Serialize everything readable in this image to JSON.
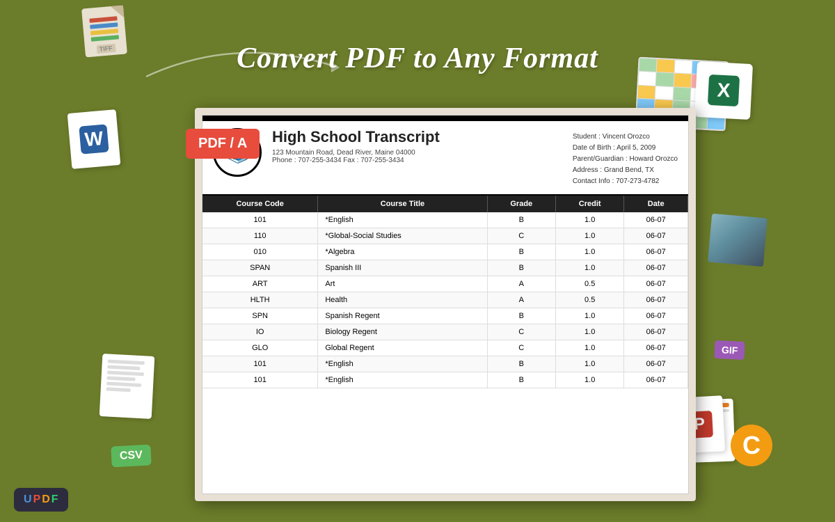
{
  "headline": "Convert PDF to Any Format",
  "pdf_badge": "PDF / A",
  "document": {
    "title": "High School Transcript",
    "address": "123 Mountain Road, Dead River, Maine 04000",
    "phone": "Phone : 707-255-3434    Fax : 707-255-3434",
    "student_info": {
      "student": "Student : Vincent Orozco",
      "dob": "Date of Birth : April 5,  2009",
      "guardian": "Parent/Guardian : Howard Orozco",
      "address": "Address : Grand Bend, TX",
      "contact": "Contact Info : 707-273-4782"
    },
    "table": {
      "headers": [
        "Course Code",
        "Course Title",
        "Grade",
        "Credit",
        "Date"
      ],
      "rows": [
        [
          "101",
          "*English",
          "B",
          "1.0",
          "06-07"
        ],
        [
          "110",
          "*Global-Social Studies",
          "C",
          "1.0",
          "06-07"
        ],
        [
          "010",
          "*Algebra",
          "B",
          "1.0",
          "06-07"
        ],
        [
          "SPAN",
          "Spanish III",
          "B",
          "1.0",
          "06-07"
        ],
        [
          "ART",
          "Art",
          "A",
          "0.5",
          "06-07"
        ],
        [
          "HLTH",
          "Health",
          "A",
          "0.5",
          "06-07"
        ],
        [
          "SPN",
          "Spanish Regent",
          "B",
          "1.0",
          "06-07"
        ],
        [
          "IO",
          "Biology Regent",
          "C",
          "1.0",
          "06-07"
        ],
        [
          "GLO",
          "Global Regent",
          "C",
          "1.0",
          "06-07"
        ],
        [
          "101",
          "*English",
          "B",
          "1.0",
          "06-07"
        ],
        [
          "101",
          "*English",
          "B",
          "1.0",
          "06-07"
        ]
      ]
    }
  },
  "updf_logo": "UPDF",
  "file_types": {
    "tiff": "TIFF",
    "csv": "CSV",
    "gif": "GIF"
  }
}
